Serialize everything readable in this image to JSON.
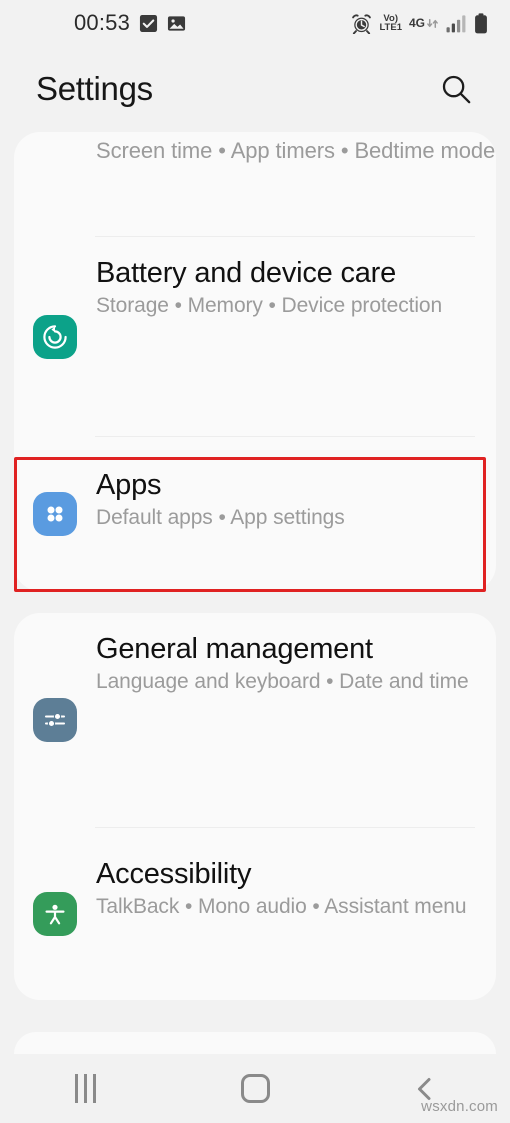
{
  "status_bar": {
    "time": "00:53",
    "left_icons": [
      "checkbox-checked-icon",
      "image-icon"
    ],
    "right_icons": [
      "alarm-icon",
      "volte-icon",
      "4g-data-icon",
      "signal-bars-icon",
      "battery-icon"
    ],
    "volte_top": "Vo)",
    "volte_bottom": "LTE1",
    "network_type": "4G"
  },
  "header": {
    "title": "Settings",
    "search_icon": "search-icon"
  },
  "colors": {
    "background": "#f2f2f2",
    "card": "#fafafa",
    "title_text": "#111111",
    "subtitle_text": "#9b9b9b",
    "highlight": "#e02222",
    "icon_battery": "#0ca289",
    "icon_apps": "#5a9be0",
    "icon_general": "#5d7e96",
    "icon_accessibility": "#349c5a"
  },
  "cards": [
    {
      "name": "card-one",
      "rows": [
        {
          "name": "digital-wellbeing",
          "title": "",
          "subtitle": "Screen time • App timers • Bedtime mode",
          "icon": "",
          "partial": true
        },
        {
          "name": "battery-and-device-care",
          "title": "Battery and device care",
          "subtitle": "Storage • Memory • Device protection",
          "icon": "battery-device-care-icon",
          "icon_color": "#0ca289"
        },
        {
          "name": "apps",
          "title": "Apps",
          "subtitle": "Default apps • App settings",
          "icon": "apps-grid-icon",
          "icon_color": "#5a9be0",
          "highlighted": true
        }
      ]
    },
    {
      "name": "card-two",
      "rows": [
        {
          "name": "general-management",
          "title": "General management",
          "subtitle": "Language and keyboard • Date and time",
          "icon": "sliders-icon",
          "icon_color": "#5d7e96"
        },
        {
          "name": "accessibility",
          "title": "Accessibility",
          "subtitle": "TalkBack • Mono audio • Assistant menu",
          "icon": "accessibility-person-icon",
          "icon_color": "#349c5a"
        }
      ]
    }
  ],
  "nav_bar": {
    "recents_label": "recents-icon",
    "home_label": "home-icon",
    "back_label": "back-icon"
  },
  "watermark": "wsxdn.com"
}
